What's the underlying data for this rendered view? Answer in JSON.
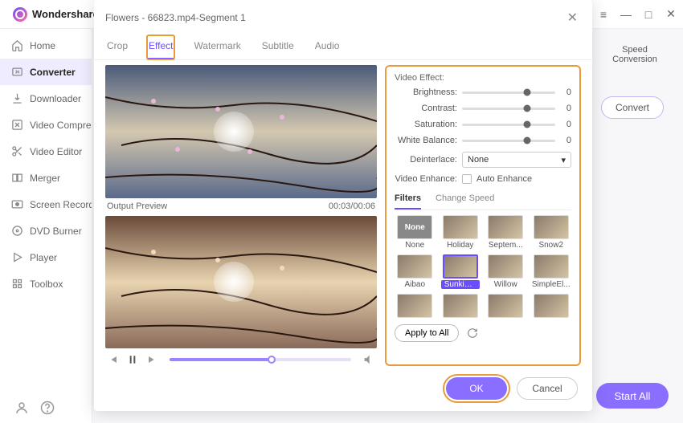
{
  "app": {
    "name": "Wondershare"
  },
  "window_controls": [
    "menu",
    "minimize",
    "maximize",
    "close"
  ],
  "sidebar": {
    "items": [
      {
        "label": "Home",
        "icon": "home-icon"
      },
      {
        "label": "Converter",
        "icon": "converter-icon",
        "active": true
      },
      {
        "label": "Downloader",
        "icon": "download-icon"
      },
      {
        "label": "Video Compressor",
        "icon": "compress-icon"
      },
      {
        "label": "Video Editor",
        "icon": "scissors-icon"
      },
      {
        "label": "Merger",
        "icon": "merger-icon"
      },
      {
        "label": "Screen Recorder",
        "icon": "record-icon"
      },
      {
        "label": "DVD Burner",
        "icon": "disc-icon"
      },
      {
        "label": "Player",
        "icon": "play-icon"
      },
      {
        "label": "Toolbox",
        "icon": "toolbox-icon"
      }
    ]
  },
  "right": {
    "speed_conversion": "Speed Conversion",
    "convert": "Convert",
    "start_all": "Start All"
  },
  "dialog": {
    "title": "Flowers - 66823.mp4-Segment 1",
    "tabs": [
      "Crop",
      "Effect",
      "Watermark",
      "Subtitle",
      "Audio"
    ],
    "active_tab": "Effect",
    "preview_label": "Output Preview",
    "time_current": "00:03",
    "time_total": "00:06",
    "video_effect": {
      "title": "Video Effect:",
      "sliders": [
        {
          "label": "Brightness:",
          "value": 0,
          "pos": 70
        },
        {
          "label": "Contrast:",
          "value": 0,
          "pos": 70
        },
        {
          "label": "Saturation:",
          "value": 0,
          "pos": 70
        },
        {
          "label": "White Balance:",
          "value": 0,
          "pos": 70
        }
      ],
      "deinterlace_label": "Deinterlace:",
      "deinterlace_value": "None",
      "enhance_label": "Video Enhance:",
      "auto_enhance": "Auto Enhance"
    },
    "sub_tabs": [
      "Filters",
      "Change Speed"
    ],
    "active_sub_tab": "Filters",
    "filters": [
      {
        "label": "None",
        "none": true
      },
      {
        "label": "Holiday"
      },
      {
        "label": "Septem..."
      },
      {
        "label": "Snow2"
      },
      {
        "label": "Aibao"
      },
      {
        "label": "Sunkissed",
        "selected": true
      },
      {
        "label": "Willow"
      },
      {
        "label": "SimpleEl..."
      },
      {
        "label": ""
      },
      {
        "label": ""
      },
      {
        "label": ""
      },
      {
        "label": ""
      }
    ],
    "apply_all": "Apply to All",
    "ok": "OK",
    "cancel": "Cancel"
  }
}
